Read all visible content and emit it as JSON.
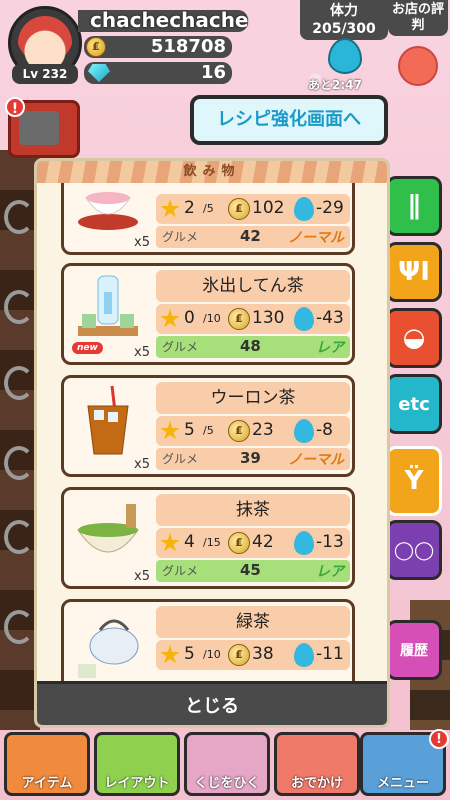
{
  "header": {
    "username": "chachechache",
    "coins": "518708",
    "coin_symbol": "₤",
    "gems": "16",
    "level": "Lv 232",
    "stamina_label": "体力",
    "stamina_value": "205/300",
    "stamina_timer": "あと2:47",
    "reputation_label": "お店の評判",
    "tv_alert": "!"
  },
  "recipe_button": "レシピ強化画面へ",
  "panel": {
    "title": "飲み物",
    "items": [
      {
        "name": "",
        "level": "2",
        "max": "/5",
        "cost": "102",
        "stamina": "-29",
        "gourmet_label": "グルメ",
        "gourmet": "42",
        "rank": "ノーマル",
        "qty": "x5",
        "new": ""
      },
      {
        "name": "氷出してん茶",
        "level": "0",
        "max": "/10",
        "cost": "130",
        "stamina": "-43",
        "gourmet_label": "グルメ",
        "gourmet": "48",
        "rank": "レア",
        "qty": "x5",
        "new": "new"
      },
      {
        "name": "ウーロン茶",
        "level": "5",
        "max": "/5",
        "cost": "23",
        "stamina": "-8",
        "gourmet_label": "グルメ",
        "gourmet": "39",
        "rank": "ノーマル",
        "qty": "x5",
        "new": ""
      },
      {
        "name": "抹茶",
        "level": "4",
        "max": "/15",
        "cost": "42",
        "stamina": "-13",
        "gourmet_label": "グルメ",
        "gourmet": "45",
        "rank": "レア",
        "qty": "x5",
        "new": ""
      },
      {
        "name": "緑茶",
        "level": "5",
        "max": "/10",
        "cost": "38",
        "stamina": "-11",
        "gourmet_label": "グルメ",
        "gourmet": "",
        "rank": "",
        "qty": "x5",
        "new": ""
      }
    ],
    "close_label": "とじる"
  },
  "categories": [
    {
      "icon": "chopsticks-icon",
      "symbol": "∥",
      "color": "#2fbf4a"
    },
    {
      "icon": "fork-knife-icon",
      "symbol": "ΨΙ",
      "color": "#f2a51a"
    },
    {
      "icon": "spoon-icon",
      "symbol": "◒",
      "color": "#e8502f"
    },
    {
      "icon": "etc-icon",
      "symbol": "etc",
      "color": "#23b7c9"
    },
    {
      "icon": "drink-icon",
      "symbol": "Ÿ",
      "color": "#f2a51a"
    },
    {
      "icon": "eggs-icon",
      "symbol": "◯◯",
      "color": "#7c3fb0"
    },
    {
      "icon": "history-icon",
      "symbol": "履歴",
      "color": "#d64fb6"
    }
  ],
  "bottom_nav": {
    "items": [
      "アイテム",
      "レイアウト",
      "くじをひく",
      "おでかけ",
      "メニュー"
    ],
    "menu_badge": "!"
  },
  "colors": {
    "normal_rank": "#e07a12",
    "rare_rank": "#3aa33a",
    "accent": "#1a9ac9"
  }
}
